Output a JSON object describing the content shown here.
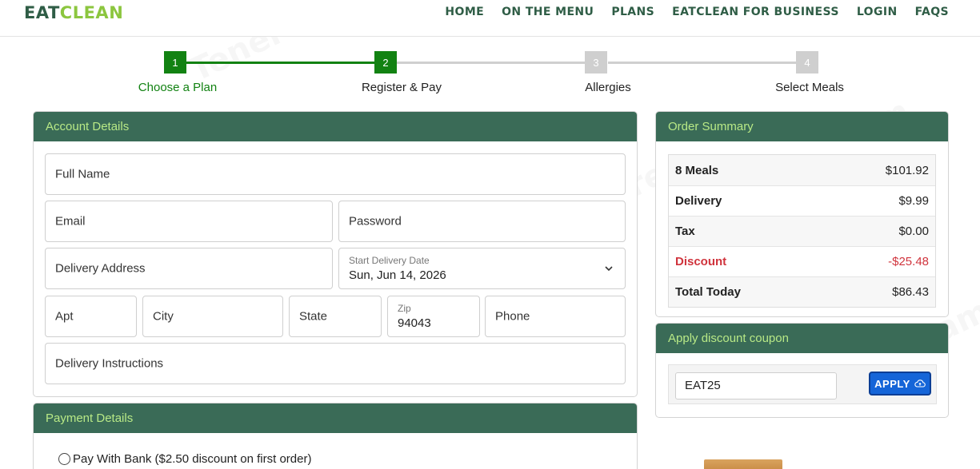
{
  "brand": {
    "part1": "EAT",
    "part2": "CLEAN",
    "colors": {
      "dark_green": "#2f5d46",
      "lime": "#8cc63f"
    }
  },
  "nav": [
    "HOME",
    "ON THE MENU",
    "PLANS",
    "EATCLEAN FOR BUSINESS",
    "LOGIN",
    "FAQS"
  ],
  "stepper": {
    "steps": [
      {
        "num": "1",
        "label": "Choose a Plan",
        "state": "done"
      },
      {
        "num": "2",
        "label": "Register & Pay",
        "state": "current"
      },
      {
        "num": "3",
        "label": "Allergies",
        "state": "todo"
      },
      {
        "num": "4",
        "label": "Select Meals",
        "state": "todo"
      }
    ],
    "colors": {
      "done": "#128212",
      "todo": "#cfcfcf"
    }
  },
  "account": {
    "title": "Account Details",
    "full_name": "Full Name",
    "email": "Email",
    "password": "Password",
    "address": "Delivery Address",
    "start_date_label": "Start Delivery Date",
    "start_date_value": "Sun, Jun 14, 2026",
    "apt": "Apt",
    "city": "City",
    "state": "State",
    "zip_label": "Zip",
    "zip_value": "94043",
    "phone": "Phone",
    "instructions": "Delivery Instructions"
  },
  "payment": {
    "title": "Payment Details",
    "bank_option": "Pay With Bank ($2.50 discount on first order)"
  },
  "summary": {
    "title": "Order Summary",
    "rows": [
      {
        "label": "8 Meals",
        "amount": "$101.92"
      },
      {
        "label": "Delivery",
        "amount": "$9.99"
      },
      {
        "label": "Tax",
        "amount": "$0.00"
      },
      {
        "label": "Discount",
        "amount": "-$25.48"
      },
      {
        "label": "Total Today",
        "amount": "$86.43"
      }
    ]
  },
  "coupon": {
    "title": "Apply discount coupon",
    "code": "EAT25",
    "button": "APPLY"
  },
  "theme": {
    "panel_header": "#3a6b57",
    "panel_header_text": "#b8e986",
    "discount_red": "#d0343d",
    "apply_blue": "#1565d8"
  }
}
